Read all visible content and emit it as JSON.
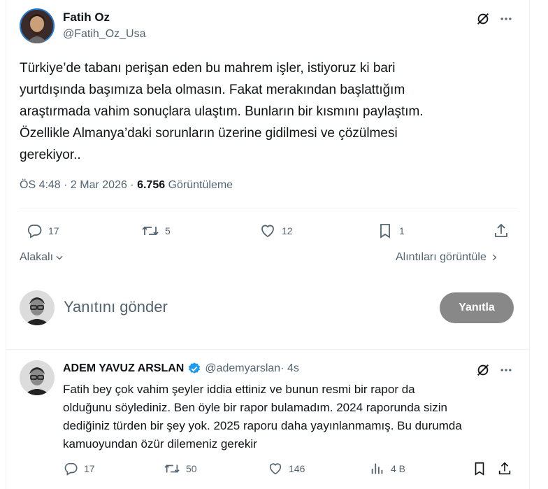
{
  "tweet": {
    "author_name": "Fatih Oz",
    "author_handle": "@Fatih_Oz_Usa",
    "text_lines": [
      "Türkiye’de tabanı perişan eden bu mahrem işler, istiyoruz ki bari",
      "yurtdışında başımıza bela olmasın. Fakat merakından başlattığım",
      "araştırmada vahim sonuçlara ulaştım. Bunların bir kısmını paylaştım.",
      "Özellikle Almanya’daki sorunların üzerine gidilmesi ve çözülmesi",
      "gerekiyor.."
    ],
    "time": "ÖS 4:48 · 2 Mar 2026 · ",
    "views_count": "6.756",
    "views_label": " Görüntüleme",
    "replies": "17",
    "reposts": "5",
    "likes": "12",
    "bookmarks": "1"
  },
  "sort": {
    "relevance_label": "Alakalı",
    "quotes_link": "Alıntıları görüntüle"
  },
  "composer": {
    "placeholder": "Yanıtını gönder",
    "submit_label": "Yanıtla"
  },
  "reply": {
    "author_name": "ADEM YAVUZ ARSLAN",
    "author_handle": "@ademyarslan",
    "time": " · 4s",
    "text_lines": [
      "Fatih bey çok vahim şeyler iddia ettiniz ve bunun resmi bir rapor da",
      "olduğunu söylediniz. Ben öyle bir rapor bulamadım. 2024 raporunda sizin",
      "dediğiniz türden bir şey yok. 2025 raporu daha yayınlanmamış. Bu durumda",
      "kamuoyundan özür dilemeniz gerekir"
    ],
    "replies": "17",
    "reposts": "50",
    "likes": "146",
    "views": "4 B"
  },
  "icons": [
    "grok-icon",
    "more-icon",
    "reply-icon",
    "repost-icon",
    "like-icon",
    "bookmark-icon",
    "share-icon",
    "chevron-down-icon",
    "chevron-right-icon",
    "verified-icon",
    "views-icon"
  ],
  "colors": {
    "verified": "#1d9bf0",
    "secondary_text": "#536471",
    "button_disabled": "#888888"
  }
}
